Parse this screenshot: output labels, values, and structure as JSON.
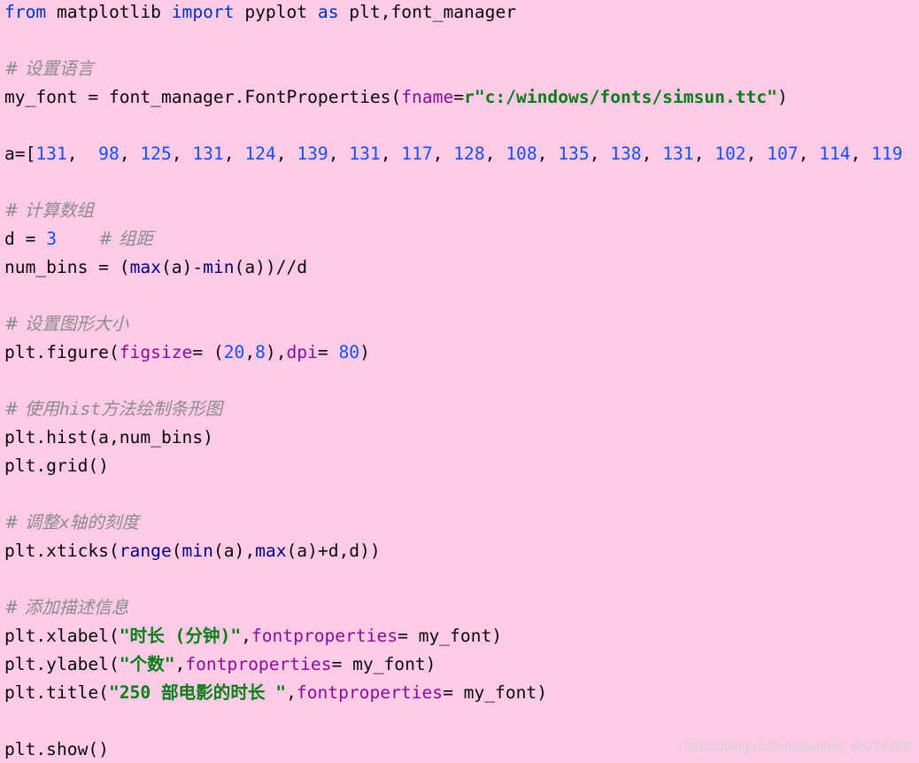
{
  "code": {
    "line_import": {
      "kw_from": "from",
      "module": "matplotlib",
      "kw_import": "import",
      "name": "pyplot",
      "kw_as": "as",
      "rest": "plt,font_manager"
    },
    "comment_language": "# 设置语言",
    "line_font": {
      "prefix": "my_font = font_manager.FontProperties(",
      "param": "fname",
      "eq": "=",
      "string": "r\"c:/windows/fonts/simsun.ttc\"",
      "suffix": ")"
    },
    "line_a": {
      "prefix": "a=[",
      "values": [
        "131",
        "98",
        "125",
        "131",
        "124",
        "139",
        "131",
        "117",
        "128",
        "108",
        "135",
        "138",
        "131",
        "102",
        "107",
        "114",
        "119"
      ]
    },
    "comment_calc": "# 计算数组",
    "line_d": {
      "prefix": "d = ",
      "value": "3",
      "comment": "# 组距"
    },
    "line_num_bins": {
      "prefix": "num_bins = (",
      "max": "max",
      "mid": "(a)-",
      "min": "min",
      "suffix": "(a))//d"
    },
    "comment_figsize": "# 设置图形大小",
    "line_figure": {
      "prefix": "plt.figure(",
      "param_figsize": "figsize",
      "eq1": "= (",
      "val1": "20",
      "comma1": ",",
      "val2": "8",
      "mid": "),",
      "param_dpi": "dpi",
      "eq2": "= ",
      "val3": "80",
      "suffix": ")"
    },
    "comment_hist_prefix": "# 使用",
    "comment_hist_mono": "hist",
    "comment_hist_suffix": "方法绘制条形图",
    "line_hist": "plt.hist(a,num_bins)",
    "line_grid": "plt.grid()",
    "comment_xticks_prefix": "# 调整",
    "comment_xticks_mono": "x",
    "comment_xticks_suffix": "轴的刻度",
    "line_xticks": {
      "prefix": "plt.xticks(",
      "range": "range",
      "p1": "(",
      "min": "min",
      "p2": "(a),",
      "max": "max",
      "suffix": "(a)+d,d))"
    },
    "comment_desc": "# 添加描述信息",
    "line_xlabel": {
      "prefix": "plt.xlabel(",
      "string": "\"时长 (分钟)\"",
      "comma": ",",
      "param": "fontproperties",
      "suffix": "= my_font)"
    },
    "line_ylabel": {
      "prefix": "plt.ylabel(",
      "string": "\"个数\"",
      "comma": ",",
      "param": "fontproperties",
      "suffix": "= my_font)"
    },
    "line_title": {
      "prefix": "plt.title(",
      "string": "\"250 部电影的时长 \"",
      "comma": ",",
      "param": "fontproperties",
      "suffix": "= my_font)"
    },
    "line_show": "plt.show()"
  },
  "watermark": "https://blog.csdn.net/weixin_46274168",
  "colors": {
    "background": "#fecbe6",
    "keyword": "#0033b3",
    "number": "#1750eb",
    "string": "#067d17",
    "parameter": "#871094",
    "builtin": "#000080",
    "comment": "#8c8c8c",
    "text": "#080808"
  }
}
